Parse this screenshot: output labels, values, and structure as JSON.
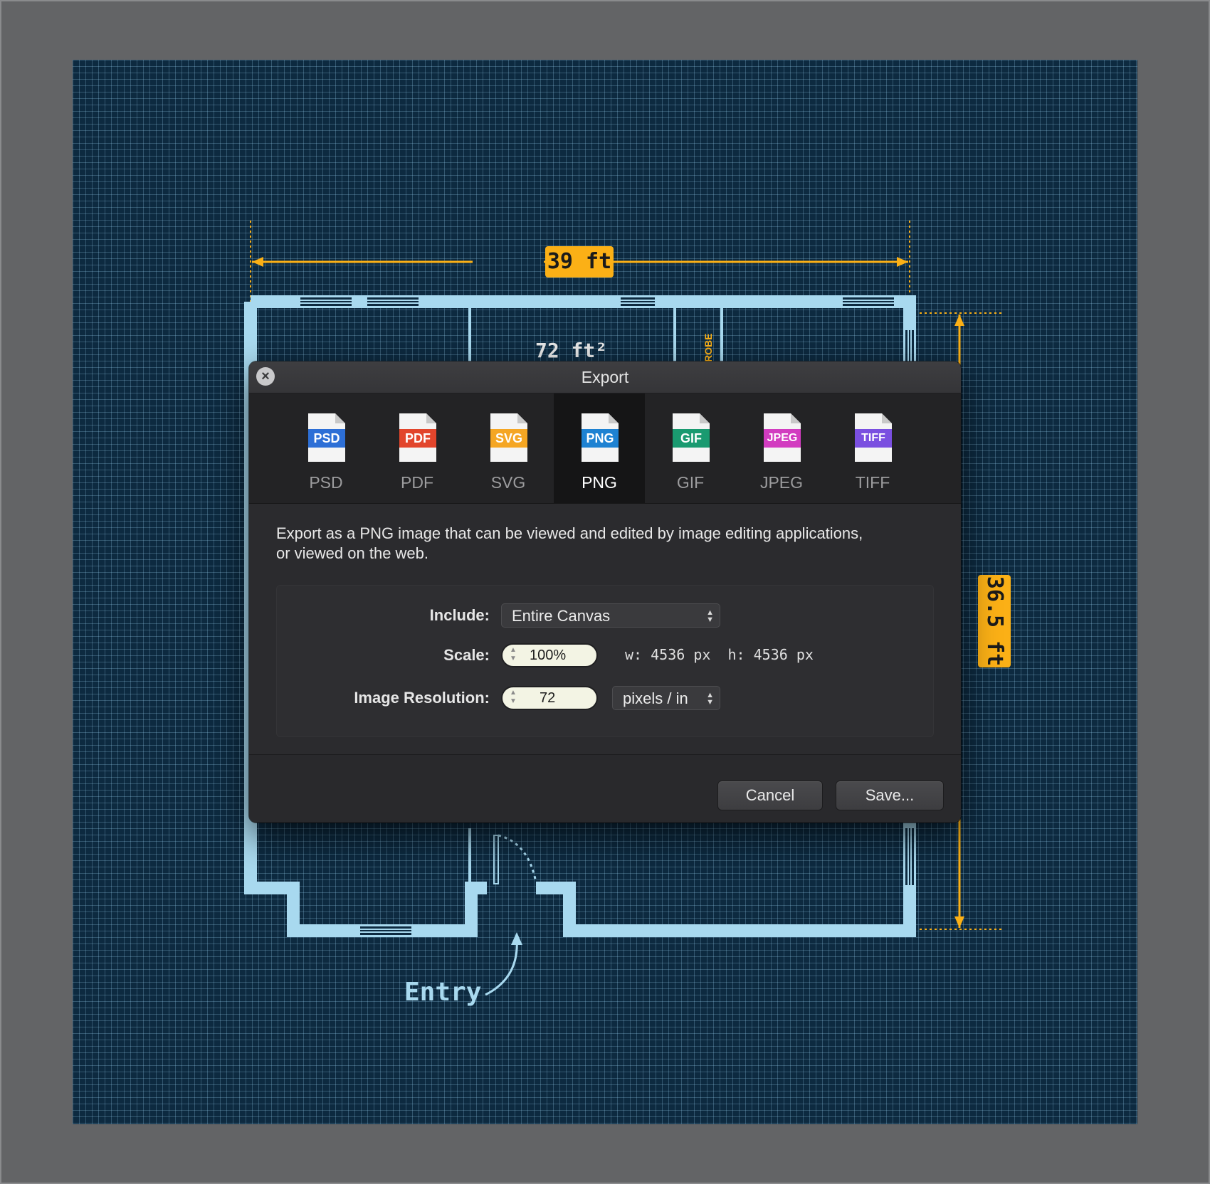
{
  "canvas": {
    "dimension_width": "39 ft",
    "dimension_height": "36.5 ft",
    "entry_label": "Entry",
    "robe_label": "ROBE",
    "partial_label": "72 ft²"
  },
  "dialog": {
    "title": "Export",
    "close_icon": "close-icon",
    "formats": [
      {
        "label": "PSD",
        "badge": "PSD",
        "color": "#2d6fd6",
        "selected": false
      },
      {
        "label": "PDF",
        "badge": "PDF",
        "color": "#e2452c",
        "selected": false
      },
      {
        "label": "SVG",
        "badge": "SVG",
        "color": "#f5a623",
        "selected": false
      },
      {
        "label": "PNG",
        "badge": "PNG",
        "color": "#1e82d2",
        "selected": true
      },
      {
        "label": "GIF",
        "badge": "GIF",
        "color": "#1a9a70",
        "selected": false
      },
      {
        "label": "JPEG",
        "badge": "JPEG",
        "color": "#d23cc0",
        "selected": false
      },
      {
        "label": "TIFF",
        "badge": "TIFF",
        "color": "#7a4fe0",
        "selected": false
      }
    ],
    "description_line1": "Export as a PNG image that can be viewed and edited by image editing applications,",
    "description_line2": "or viewed on the web.",
    "options": {
      "include_label": "Include:",
      "include_value": "Entire Canvas",
      "scale_label": "Scale:",
      "scale_value": "100%",
      "size_readout": "w: 4536 px  h: 4536 px",
      "resolution_label": "Image Resolution:",
      "resolution_value": "72",
      "resolution_unit": "pixels / in"
    },
    "cancel_label": "Cancel",
    "save_label": "Save..."
  },
  "colors": {
    "blueprint_bg": "#0d2a40",
    "wall": "#a8d9ef",
    "dimension": "#fbb016"
  }
}
